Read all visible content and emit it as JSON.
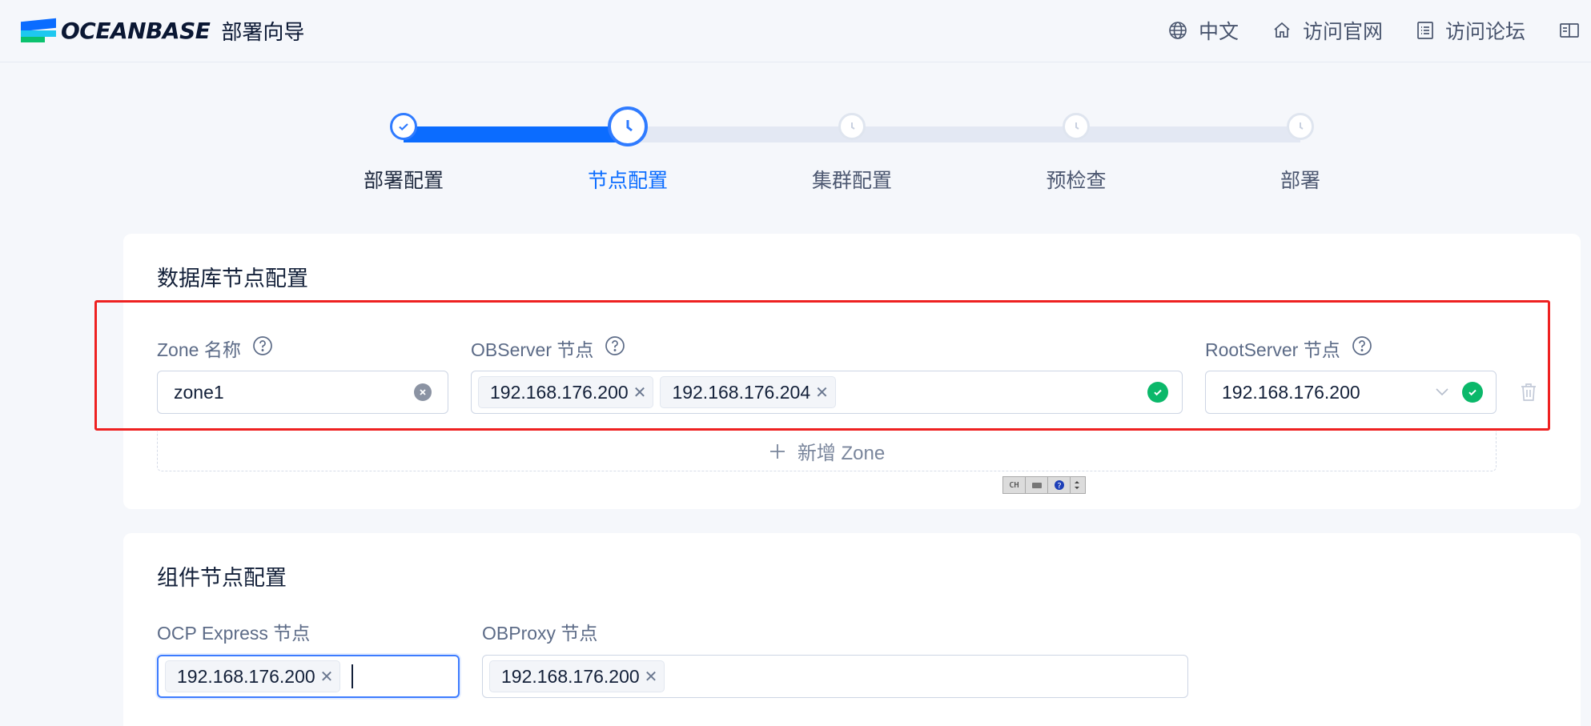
{
  "header": {
    "logo_text": "OCEANBASE",
    "app_title": "部署向导",
    "nav": [
      {
        "label": "中文",
        "icon": "globe-icon"
      },
      {
        "label": "访问官网",
        "icon": "home-icon"
      },
      {
        "label": "访问论坛",
        "icon": "forum-icon"
      }
    ]
  },
  "steps": [
    {
      "label": "部署配置",
      "status": "done"
    },
    {
      "label": "节点配置",
      "status": "active"
    },
    {
      "label": "集群配置",
      "status": "pending"
    },
    {
      "label": "预检查",
      "status": "pending"
    },
    {
      "label": "部署",
      "status": "pending"
    }
  ],
  "db_nodes": {
    "title": "数据库节点配置",
    "zone_label": "Zone 名称",
    "zone_value": "zone1",
    "observer_label": "OBServer 节点",
    "observer_tags": [
      "192.168.176.200",
      "192.168.176.204"
    ],
    "rootserver_label": "RootServer 节点",
    "rootserver_value": "192.168.176.200",
    "add_zone_label": "新增 Zone"
  },
  "component_nodes": {
    "title": "组件节点配置",
    "ocp_label": "OCP Express 节点",
    "ocp_tags": [
      "192.168.176.200"
    ],
    "obproxy_label": "OBProxy 节点",
    "obproxy_tags": [
      "192.168.176.200"
    ]
  },
  "ime_bar": {
    "mode": "CH"
  },
  "colors": {
    "accent": "#0b6cff",
    "success": "#0bb86a",
    "highlight": "#ee2121"
  }
}
